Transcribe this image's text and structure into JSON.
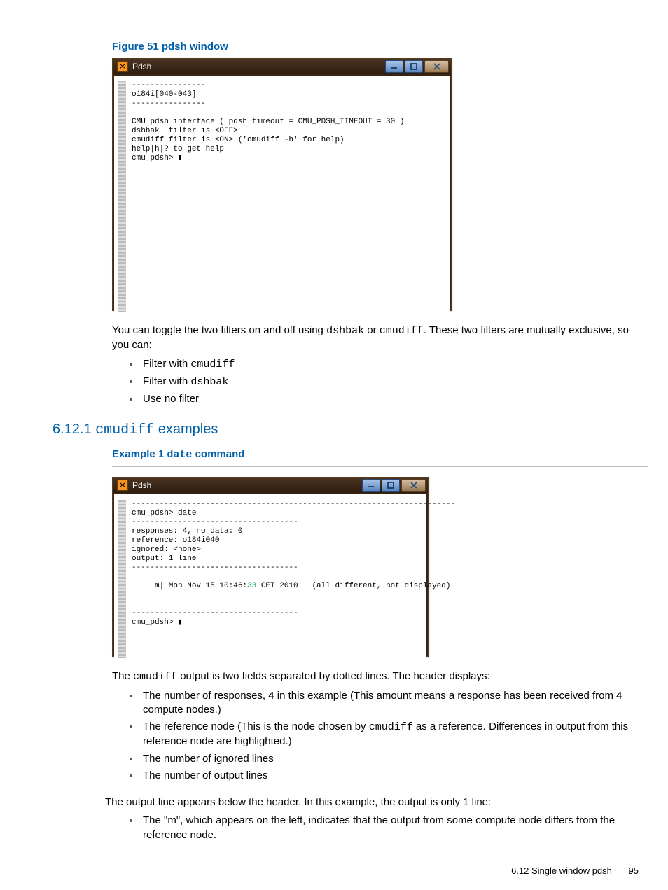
{
  "figure51": {
    "caption_prefix": "Figure 51 pdsh window",
    "window_title": "Pdsh",
    "content": "----------------\no184i[040-043]\n----------------\n\nCMU pdsh interface ( pdsh timeout = CMU_PDSH_TIMEOUT = 30 )\ndshbak  filter is <OFF>\ncmudiff filter is <ON> ('cmudiff -h' for help)\nhelp|h|? to get help\ncmu_pdsh> ▮"
  },
  "para1_parts": [
    "You can toggle the two filters on and off using ",
    "dshbak",
    " or ",
    "cmudiff",
    ". These two filters are mutually exclusive, so you can:"
  ],
  "filters_list": [
    {
      "prefix": "Filter with ",
      "code": "cmudiff"
    },
    {
      "prefix": "Filter with ",
      "code": "dshbak"
    },
    {
      "prefix": "Use no filter",
      "code": ""
    }
  ],
  "section_num": "6.12.1 ",
  "section_code": "cmudiff",
  "section_rest": " examples",
  "example1_parts": [
    "Example 1 ",
    "date",
    " command"
  ],
  "figure_ex1": {
    "window_title": "Pdsh",
    "pre": "----------------------------------------------------------------------\ncmu_pdsh> date\n------------------------------------\nresponses: 4, no data: 0\nreference: o184i040\nignored: <none>\noutput: 1 line\n------------------------------------\n\n     m| Mon Nov 15 10:46:",
    "highlight": "33",
    "post": " CET 2010 | (all different, not displayed)\n\n\n------------------------------------\ncmu_pdsh> ▮"
  },
  "para2_parts": [
    "The ",
    "cmudiff",
    " output is two fields separated by dotted lines. The header displays:"
  ],
  "header_list": [
    {
      "text_a": "The number of responses, 4 in this example (This amount means a response has been received from 4 compute nodes.)",
      "code": "",
      "text_b": ""
    },
    {
      "text_a": "The reference node (This is the node chosen by ",
      "code": "cmudiff",
      "text_b": " as a reference. Differences in output from this reference node are highlighted.)"
    },
    {
      "text_a": "The number of ignored lines",
      "code": "",
      "text_b": ""
    },
    {
      "text_a": "The number of output lines",
      "code": "",
      "text_b": ""
    }
  ],
  "para3": "The output line appears below the header. In this example, the output is only 1 line:",
  "output_list": [
    "The \"m\", which appears on the left, indicates that the output from some compute node differs from the reference node."
  ],
  "footer_section": "6.12 Single window pdsh",
  "footer_page": "95"
}
